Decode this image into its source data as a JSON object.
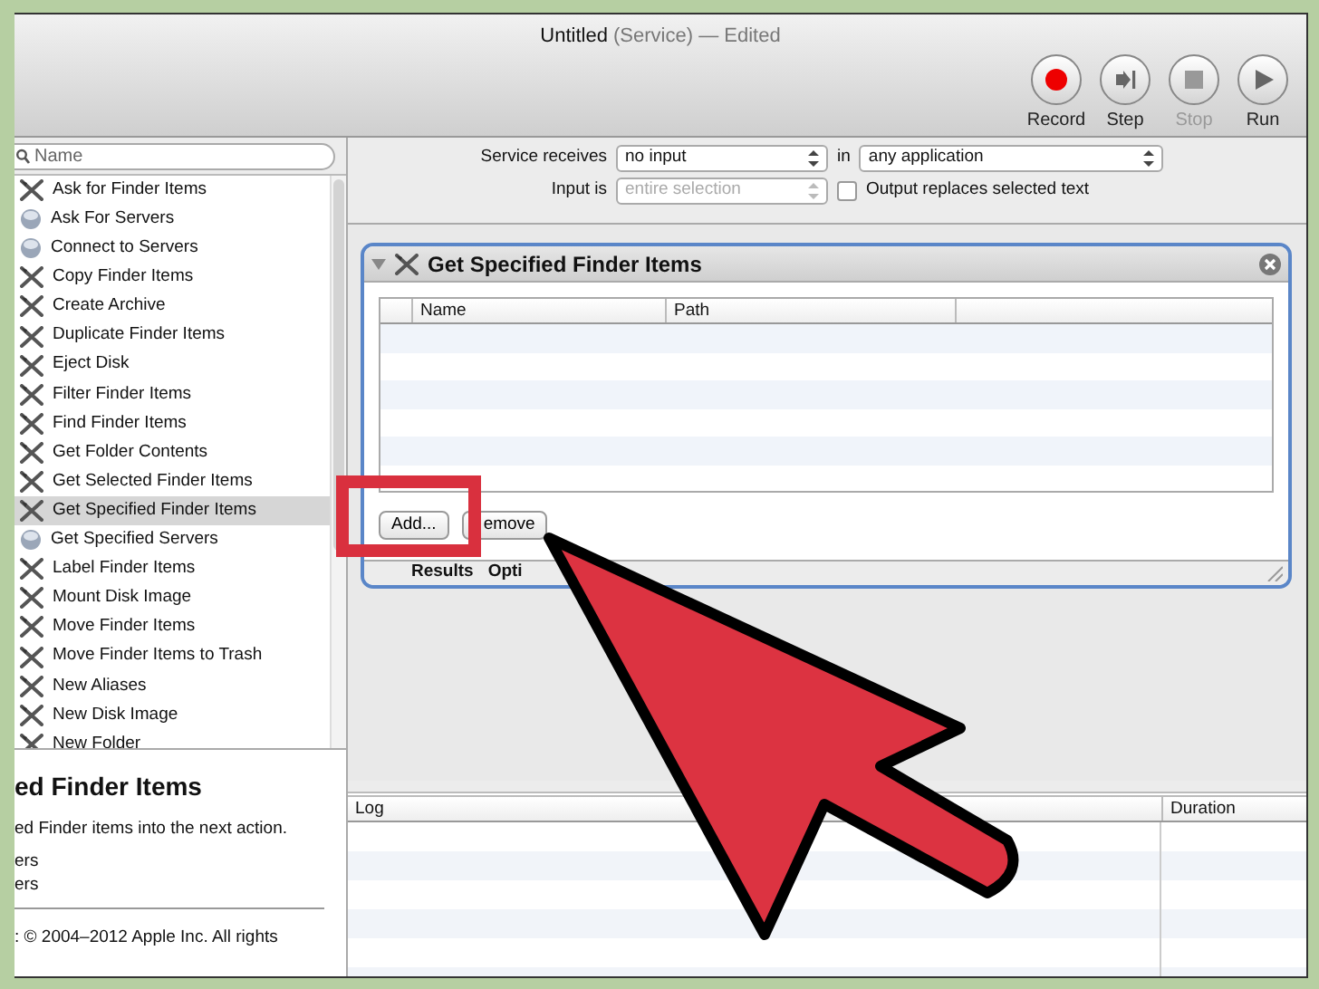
{
  "window": {
    "title": "Untitled",
    "subtitle": "(Service) — Edited"
  },
  "toolbar": [
    {
      "label": "Record",
      "kind": "record",
      "disabled": false
    },
    {
      "label": "Step",
      "kind": "step",
      "disabled": false
    },
    {
      "label": "Stop",
      "kind": "stop",
      "disabled": true
    },
    {
      "label": "Run",
      "kind": "run",
      "disabled": false
    }
  ],
  "search": {
    "placeholder": "Name"
  },
  "actions": [
    {
      "label": "Ask for Finder Items",
      "kind": "finder",
      "selected": false
    },
    {
      "label": "Ask For Servers",
      "kind": "server",
      "selected": false
    },
    {
      "label": "Connect to Servers",
      "kind": "server",
      "selected": false
    },
    {
      "label": "Copy Finder Items",
      "kind": "finder",
      "selected": false
    },
    {
      "label": "Create Archive",
      "kind": "finder",
      "selected": false
    },
    {
      "label": "Duplicate Finder Items",
      "kind": "finder",
      "selected": false
    },
    {
      "label": "Eject Disk",
      "kind": "finder",
      "selected": false
    },
    {
      "label": "Filter Finder Items",
      "kind": "finder",
      "selected": false
    },
    {
      "label": "Find Finder Items",
      "kind": "finder",
      "selected": false
    },
    {
      "label": "Get Folder Contents",
      "kind": "finder",
      "selected": false
    },
    {
      "label": "Get Selected Finder Items",
      "kind": "finder",
      "selected": false
    },
    {
      "label": "Get Specified Finder Items",
      "kind": "finder",
      "selected": true
    },
    {
      "label": "Get Specified Servers",
      "kind": "server",
      "selected": false
    },
    {
      "label": "Label Finder Items",
      "kind": "finder",
      "selected": false
    },
    {
      "label": "Mount Disk Image",
      "kind": "finder",
      "selected": false
    },
    {
      "label": "Move Finder Items",
      "kind": "finder",
      "selected": false
    },
    {
      "label": "Move Finder Items to Trash",
      "kind": "finder",
      "selected": false
    },
    {
      "label": "New Aliases",
      "kind": "finder",
      "selected": false
    },
    {
      "label": "New Disk Image",
      "kind": "finder",
      "selected": false
    },
    {
      "label": "New Folder",
      "kind": "finder",
      "selected": false
    }
  ],
  "description": {
    "title": "ed Finder Items",
    "text": "ed Finder items into the next action.",
    "lines": [
      "ers",
      "ers"
    ],
    "copyright": ": © 2004–2012 Apple Inc.  All rights"
  },
  "service": {
    "receives_label": "Service receives",
    "receives": "no input",
    "in_label": "in",
    "application": "any application",
    "input_label": "Input is",
    "input": "entire selection",
    "input_disabled": true,
    "output_label": "Output replaces selected text",
    "output_checked": false
  },
  "action_card": {
    "title": "Get Specified Finder Items",
    "expanded": true,
    "columns": [
      "Name",
      "Path"
    ],
    "buttons": [
      "Add...",
      "emove"
    ],
    "tabs": [
      "Results",
      "Opti"
    ]
  },
  "log": {
    "columns": [
      "Log",
      "Duration"
    ]
  },
  "annotations": {
    "frame": true,
    "arrow": true
  }
}
